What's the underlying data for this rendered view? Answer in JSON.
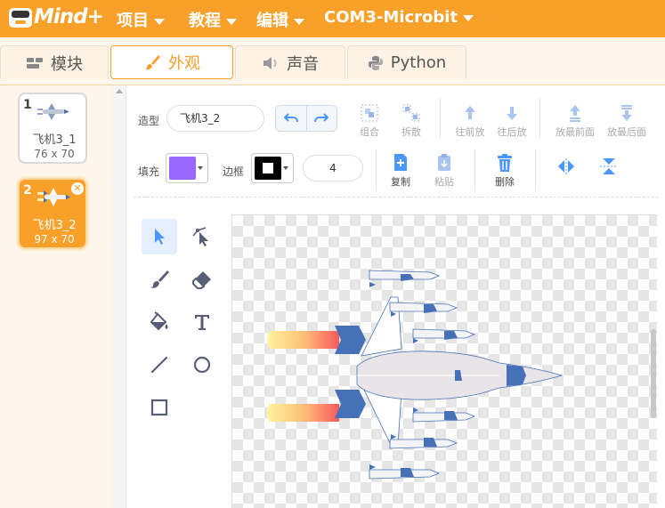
{
  "menubar": {
    "logo_text": "Mind+",
    "items": [
      {
        "label": "项目"
      },
      {
        "label": "教程"
      },
      {
        "label": "编辑"
      },
      {
        "label": "COM3-Microbit"
      }
    ]
  },
  "tabs": [
    {
      "label": "模块",
      "icon": "blocks-icon"
    },
    {
      "label": "外观",
      "icon": "brush-icon",
      "active": true
    },
    {
      "label": "声音",
      "icon": "speaker-icon"
    },
    {
      "label": "Python",
      "icon": "python-icon"
    }
  ],
  "costumes": [
    {
      "number": "1",
      "name": "飞机3_1",
      "size": "76 x 70"
    },
    {
      "number": "2",
      "name": "飞机3_2",
      "size": "97 x 70",
      "selected": true
    }
  ],
  "editor": {
    "costume_label": "造型",
    "costume_name": "飞机3_2",
    "group": "组合",
    "ungroup": "拆散",
    "forward": "往前放",
    "backward": "往后放",
    "front": "放最前面",
    "back": "放最后面",
    "fill_label": "填充",
    "outline_label": "边框",
    "outline_width": "4",
    "copy": "复制",
    "paste": "粘贴",
    "delete": "删除",
    "fill_color": "#9966ff",
    "outline_color": "#000000",
    "accent": "#4c97ff",
    "brand": "#f9a02a"
  }
}
